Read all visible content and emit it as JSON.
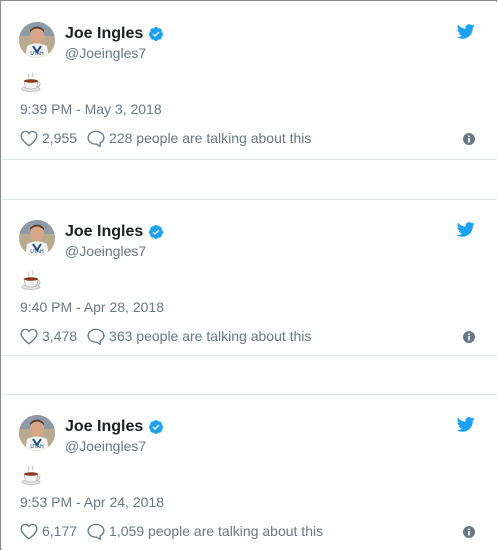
{
  "colors": {
    "name": "#1c2022",
    "secondary": "#697882",
    "twitter_blue": "#1da1f2",
    "divider": "#e1e8ed",
    "border": "#8a8a8a"
  },
  "icons": {
    "avatar": "profile-photo",
    "verified": "verified-badge-icon",
    "twitter": "twitter-bird-icon",
    "emoji": "coffee-cup-emoji",
    "like": "heart-icon",
    "reply": "speech-bubble-icon",
    "info": "info-icon"
  },
  "tweets": [
    {
      "name": "Joe Ingles",
      "handle": "@Joeingles7",
      "timestamp": "9:39 PM - May 3, 2018",
      "likes": "2,955",
      "talking": "228 people are talking about this"
    },
    {
      "name": "Joe Ingles",
      "handle": "@Joeingles7",
      "timestamp": "9:40 PM - Apr 28, 2018",
      "likes": "3,478",
      "talking": "363 people are talking about this"
    },
    {
      "name": "Joe Ingles",
      "handle": "@Joeingles7",
      "timestamp": "9:53 PM - Apr 24, 2018",
      "likes": "6,177",
      "talking": "1,059 people are talking about this"
    }
  ]
}
